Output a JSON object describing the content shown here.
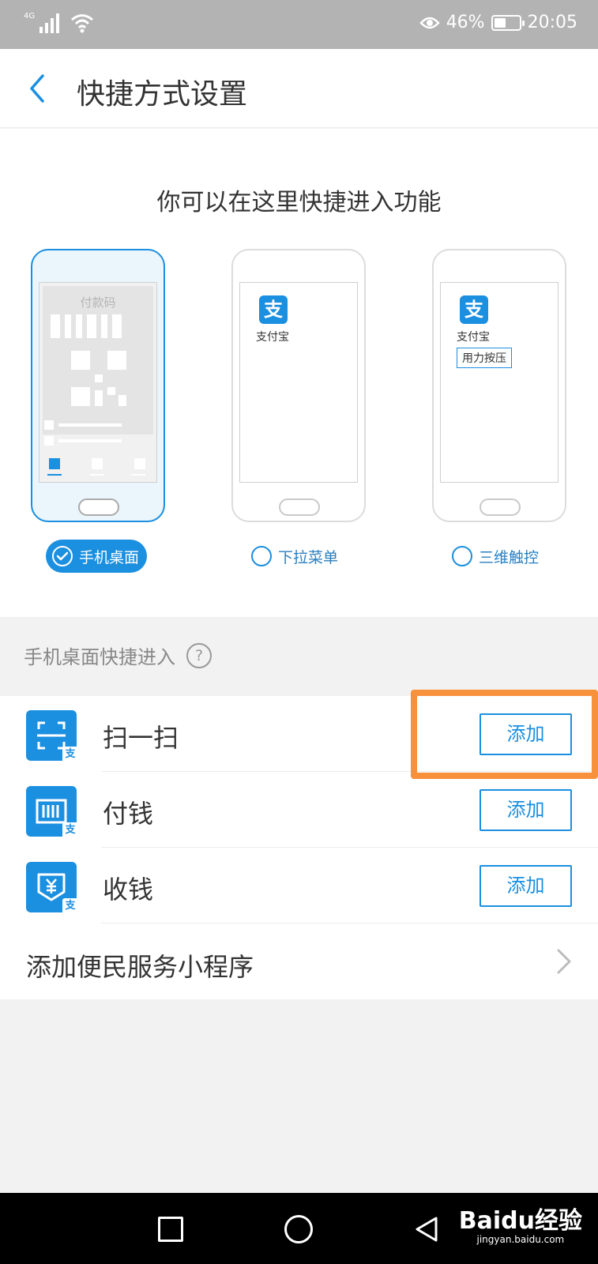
{
  "status_bar": {
    "network": "4G",
    "battery_text": "46%",
    "battery_level": 0.46,
    "time": "20:05"
  },
  "header": {
    "title": "快捷方式设置"
  },
  "intro": {
    "subtitle": "你可以在这里快捷进入功能"
  },
  "previews": {
    "paycode_label": "付款码",
    "app_name": "支付宝",
    "alipay_glyph": "支",
    "press_tip": "用力按压"
  },
  "options": [
    {
      "label": "手机桌面",
      "selected": true
    },
    {
      "label": "下拉菜单",
      "selected": false
    },
    {
      "label": "三维触控",
      "selected": false
    }
  ],
  "section": {
    "label": "手机桌面快捷进入",
    "help_glyph": "?"
  },
  "shortcuts": [
    {
      "label": "扫一扫",
      "button": "添加",
      "icon": "scan-icon",
      "badge": "支"
    },
    {
      "label": "付钱",
      "button": "添加",
      "icon": "barcode-pay-icon",
      "badge": "支"
    },
    {
      "label": "收钱",
      "button": "添加",
      "icon": "receive-money-icon",
      "badge": "支"
    }
  ],
  "service": {
    "label": "添加便民服务小程序"
  },
  "watermark": {
    "logo": "Baidu经验",
    "url": "jingyan.baidu.com"
  },
  "colors": {
    "accent": "#1b8fe0",
    "highlight": "#f7913b"
  }
}
